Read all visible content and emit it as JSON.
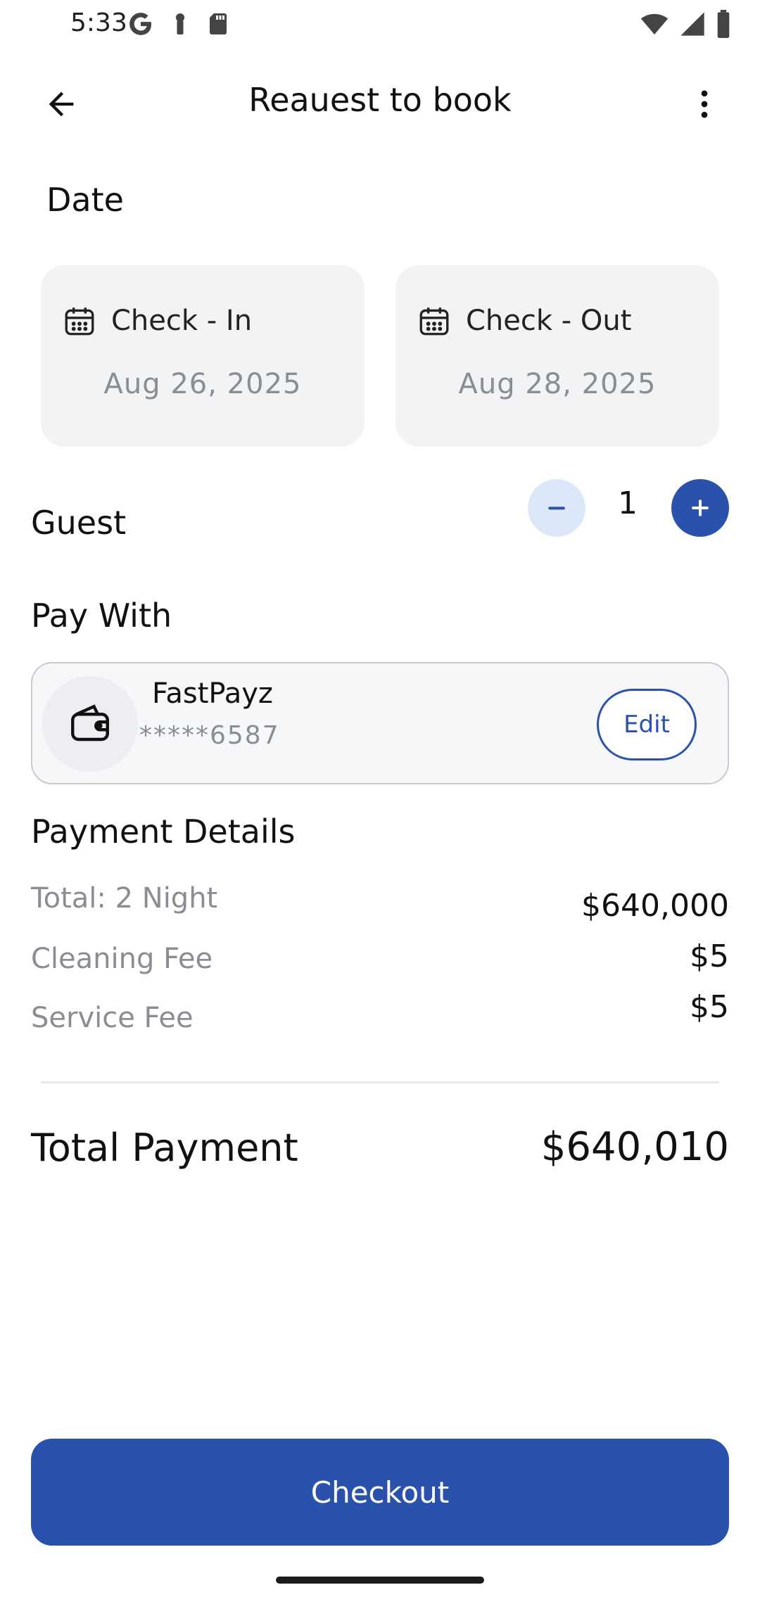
{
  "status_bar": {
    "time": "5:33",
    "left_icons": [
      "google-icon",
      "key-icon",
      "sd-card-icon"
    ],
    "right_icons": [
      "wifi-icon",
      "signal-icon",
      "battery-icon"
    ]
  },
  "header": {
    "title": "Reauest to book",
    "back_icon": "arrow-back-icon",
    "menu_icon": "more-vert-icon"
  },
  "date_section": {
    "title": "Date",
    "check_in": {
      "label": "Check - In",
      "value": "Aug 26, 2025",
      "icon": "calendar-icon"
    },
    "check_out": {
      "label": "Check - Out",
      "value": "Aug 28, 2025",
      "icon": "calendar-icon"
    }
  },
  "guest": {
    "title": "Guest",
    "count": "1"
  },
  "pay_with": {
    "title": "Pay With",
    "method_name": "FastPayz",
    "masked_number": "*****6587",
    "edit_label": "Edit",
    "icon": "wallet-icon"
  },
  "payment_details": {
    "title": "Payment Details",
    "rows": [
      {
        "label": "Total: 2 Night",
        "value": "$640,000"
      },
      {
        "label": "Cleaning Fee",
        "value": "$5"
      },
      {
        "label": "Service Fee",
        "value": "$5"
      }
    ]
  },
  "total": {
    "label": "Total Payment",
    "value": "$640,010"
  },
  "checkout_label": "Checkout",
  "colors": {
    "primary": "#2a52ad",
    "primary_light": "#dce8fa",
    "card_bg": "#f2f3f5",
    "muted_text": "#8a8d94"
  }
}
